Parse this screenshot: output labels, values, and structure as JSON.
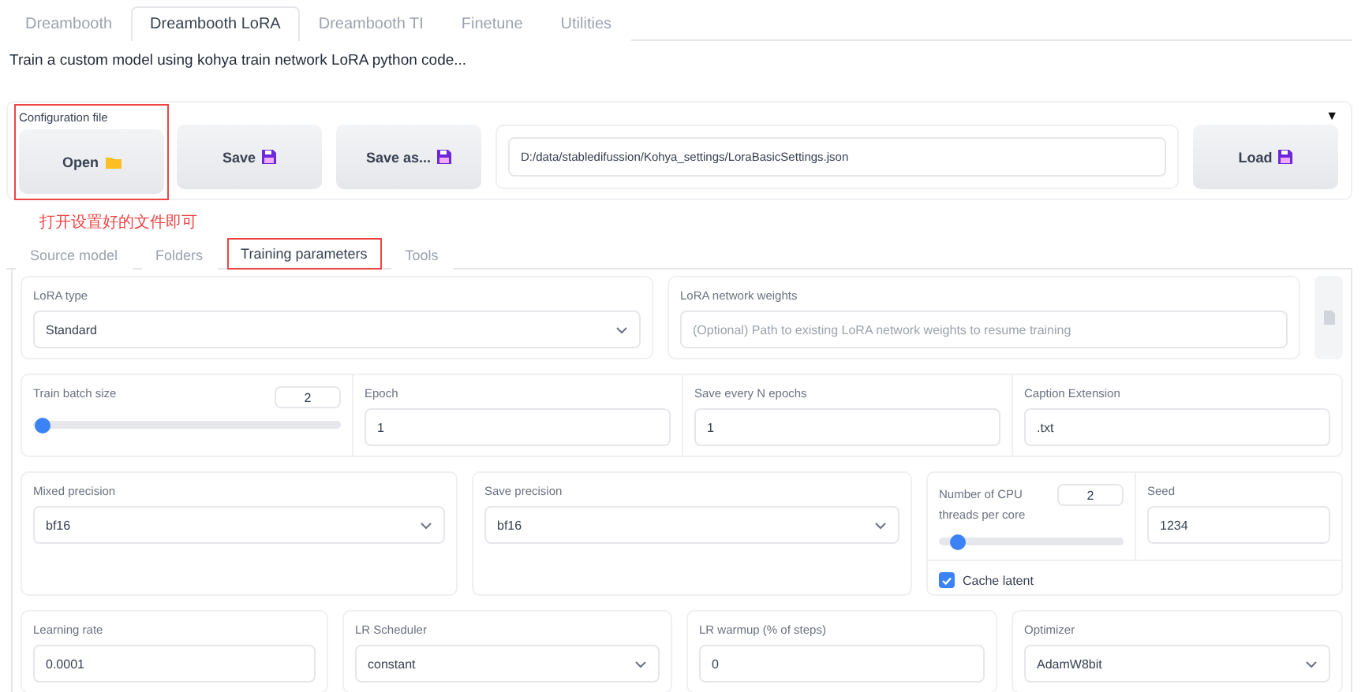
{
  "tabs": [
    {
      "label": "Dreambooth",
      "selected": false
    },
    {
      "label": "Dreambooth LoRA",
      "selected": true
    },
    {
      "label": "Dreambooth TI",
      "selected": false
    },
    {
      "label": "Finetune",
      "selected": false
    },
    {
      "label": "Utilities",
      "selected": false
    }
  ],
  "description": "Train a custom model using kohya train network LoRA python code...",
  "config": {
    "label": "Configuration file",
    "highlighted": true,
    "expanded": true,
    "collapse_glyph": "▼",
    "buttons": [
      {
        "label": "Open"
      },
      {
        "label": "Save"
      },
      {
        "label": "Save as..."
      }
    ],
    "path": "D:/data/stabledifussion/Kohya_settings/LoraBasicSettings.json",
    "load_button": {
      "label": "Load"
    }
  },
  "annotation": "打开设置好的文件即可",
  "sub_tabs": [
    {
      "label": "Source model",
      "selected": false,
      "highlighted": false
    },
    {
      "label": "Folders",
      "selected": false,
      "highlighted": false
    },
    {
      "label": "Training parameters",
      "selected": true,
      "highlighted": true
    },
    {
      "label": "Tools",
      "selected": false,
      "highlighted": false
    }
  ],
  "lora_type": {
    "label": "LoRA type",
    "value": "Standard"
  },
  "lora_weights": {
    "label": "LoRA network weights",
    "placeholder": "(Optional) Path to existing LoRA network weights to resume training"
  },
  "train_batch_size": {
    "label": "Train batch size",
    "value": "2",
    "level": 0.03
  },
  "epoch": {
    "label": "Epoch",
    "value": "1"
  },
  "save_every": {
    "label": "Save every N epochs",
    "value": "1"
  },
  "caption_extension": {
    "label": "Caption Extension",
    "value": ".txt"
  },
  "mixed_precision": {
    "label": "Mixed precision",
    "value": "bf16"
  },
  "save_precision": {
    "label": "Save precision",
    "value": "bf16"
  },
  "cpu_threads": {
    "label": "Number of CPU threads per core",
    "value": "2",
    "level": 0.1
  },
  "seed": {
    "label": "Seed",
    "value": "1234"
  },
  "cache_latent": {
    "label": "Cache latent",
    "checked": true
  },
  "learning_rate": {
    "label": "Learning rate",
    "value": "0.0001"
  },
  "lr_scheduler": {
    "label": "LR Scheduler",
    "value": "constant"
  },
  "lr_warmup": {
    "label": "LR warmup (% of steps)",
    "value": "0"
  },
  "optimizer": {
    "label": "Optimizer",
    "value": "AdamW8bit"
  }
}
